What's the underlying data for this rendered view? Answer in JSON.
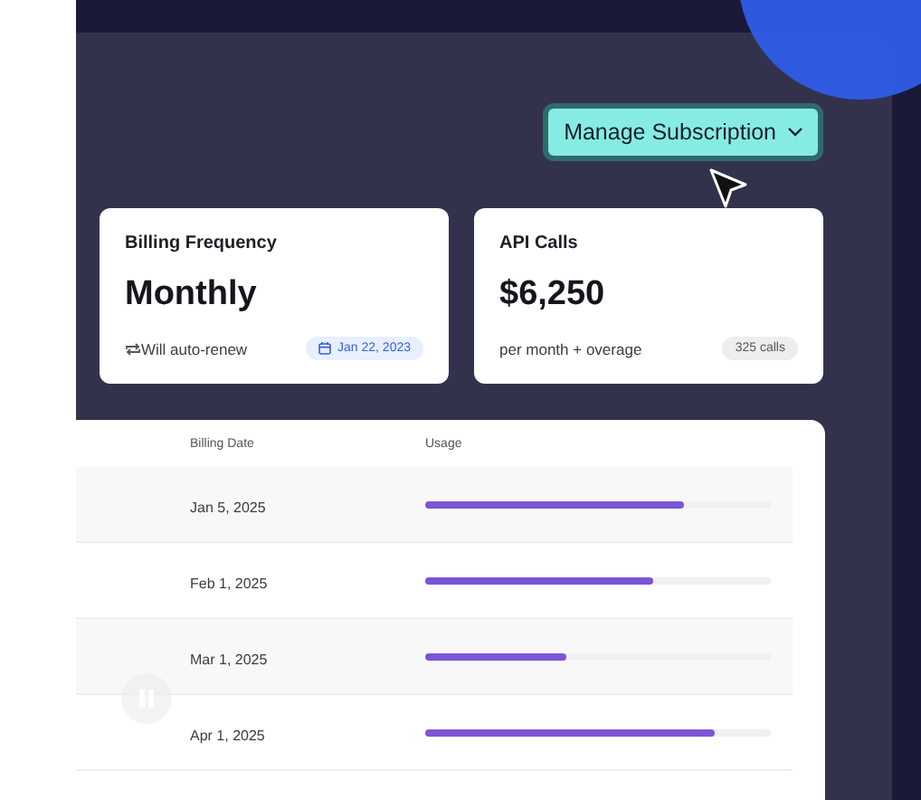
{
  "header": {
    "button": "Manage Subscription"
  },
  "cards": [
    {
      "kind": "billing",
      "title": "Billing Frequency",
      "value": "Monthly",
      "note": "Will auto-renew",
      "badge": "Jan 22, 2023"
    },
    {
      "kind": "api",
      "title": "API Calls",
      "value": "$6,250",
      "note": "per month + overage",
      "badge": "325 calls"
    }
  ],
  "table": {
    "columns": [
      "Billing Date",
      "Usage"
    ],
    "rows": [
      {
        "date": "Jan 5, 2025",
        "level": 0.75
      },
      {
        "date": "Feb 1, 2025",
        "level": 0.66
      },
      {
        "date": "Mar 1, 2025",
        "level": 0.41
      },
      {
        "date": "Apr 1, 2025",
        "level": 0.84
      }
    ]
  }
}
